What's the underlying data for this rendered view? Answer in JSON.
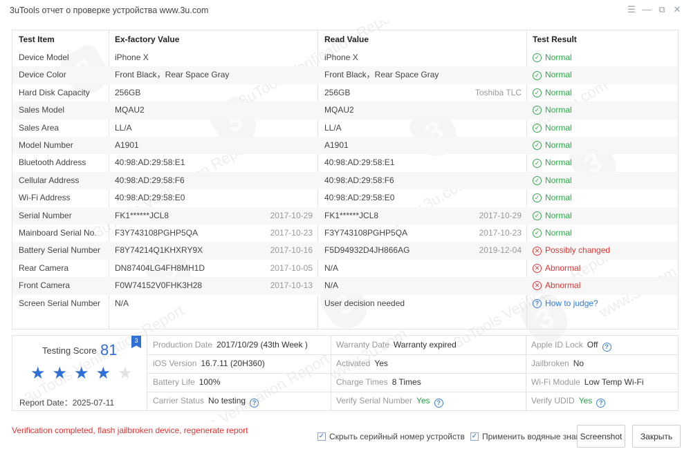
{
  "window": {
    "title": "3uTools отчет о проверке устройства www.3u.com",
    "controls": {
      "menu": "☰",
      "minimize": "—",
      "restore": "⧉",
      "close": "✕"
    }
  },
  "watermark": {
    "text": "3uTools Verification Report",
    "site": "www.3u.com",
    "logo": "3"
  },
  "table": {
    "headers": {
      "item": "Test Item",
      "factory": "Ex-factory Value",
      "read": "Read Value",
      "result": "Test Result"
    },
    "rows": [
      {
        "item": "Device Model",
        "factory": "iPhone X",
        "factory_date": "",
        "read": "iPhone X",
        "read_extra": "",
        "result": "Normal",
        "status": "ok"
      },
      {
        "item": "Device Color",
        "factory": "Front Black，Rear Space Gray",
        "factory_date": "",
        "read": "Front Black，Rear Space Gray",
        "read_extra": "",
        "result": "Normal",
        "status": "ok"
      },
      {
        "item": "Hard Disk Capacity",
        "factory": "256GB",
        "factory_date": "",
        "read": "256GB",
        "read_extra": "Toshiba TLC",
        "result": "Normal",
        "status": "ok"
      },
      {
        "item": "Sales Model",
        "factory": "MQAU2",
        "factory_date": "",
        "read": "MQAU2",
        "read_extra": "",
        "result": "Normal",
        "status": "ok"
      },
      {
        "item": "Sales Area",
        "factory": "LL/A",
        "factory_date": "",
        "read": "LL/A",
        "read_extra": "",
        "result": "Normal",
        "status": "ok"
      },
      {
        "item": "Model Number",
        "factory": "A1901",
        "factory_date": "",
        "read": "A1901",
        "read_extra": "",
        "result": "Normal",
        "status": "ok"
      },
      {
        "item": "Bluetooth Address",
        "factory": "40:98:AD:29:58:E1",
        "factory_date": "",
        "read": "40:98:AD:29:58:E1",
        "read_extra": "",
        "result": "Normal",
        "status": "ok"
      },
      {
        "item": "Cellular Address",
        "factory": "40:98:AD:29:58:F6",
        "factory_date": "",
        "read": "40:98:AD:29:58:F6",
        "read_extra": "",
        "result": "Normal",
        "status": "ok"
      },
      {
        "item": "Wi-Fi Address",
        "factory": "40:98:AD:29:58:E0",
        "factory_date": "",
        "read": "40:98:AD:29:58:E0",
        "read_extra": "",
        "result": "Normal",
        "status": "ok"
      },
      {
        "item": "Serial Number",
        "factory": "FK1******JCL8",
        "factory_date": "2017-10-29",
        "read": "FK1******JCL8",
        "read_extra": "2017-10-29",
        "result": "Normal",
        "status": "ok"
      },
      {
        "item": "Mainboard Serial No.",
        "factory": "F3Y743108PGHP5QA",
        "factory_date": "2017-10-23",
        "read": "F3Y743108PGHP5QA",
        "read_extra": "2017-10-23",
        "result": "Normal",
        "status": "ok"
      },
      {
        "item": "Battery Serial Number",
        "factory": "F8Y74214Q1KHXRY9X",
        "factory_date": "2017-10-16",
        "read": "F5D94932D4JH866AG",
        "read_extra": "2019-12-04",
        "result": "Possibly changed",
        "status": "bad"
      },
      {
        "item": "Rear Camera",
        "factory": "DN87404LG4FH8MH1D",
        "factory_date": "2017-10-05",
        "read": "N/A",
        "read_extra": "",
        "result": "Abnormal",
        "status": "bad"
      },
      {
        "item": "Front Camera",
        "factory": "F0W74152V0FHK3H28",
        "factory_date": "2017-10-13",
        "read": "N/A",
        "read_extra": "",
        "result": "Abnormal",
        "status": "bad"
      },
      {
        "item": "Screen Serial Number",
        "factory": "N/A",
        "factory_date": "",
        "read": "User decision needed",
        "read_extra": "",
        "result": "How to judge?",
        "status": "help"
      }
    ]
  },
  "summary": {
    "score_label": "Testing Score",
    "score": "81",
    "badge": "3",
    "stars_filled": 4,
    "stars_total": 5,
    "report_date": "Report Date：2025-07-11",
    "fields": [
      {
        "label": "Production Date",
        "value": "2017/10/29 (43th Week )"
      },
      {
        "label": "Warranty Date",
        "value": "Warranty expired"
      },
      {
        "label": "Apple ID Lock",
        "value": "Off"
      },
      {
        "label": "iOS Version",
        "value": "16.7.11 (20H360)"
      },
      {
        "label": "Activated",
        "value": "Yes"
      },
      {
        "label": "Jailbroken",
        "value": "No"
      },
      {
        "label": "Battery Life",
        "value": "100%"
      },
      {
        "label": "Charge Times",
        "value": "8 Times"
      },
      {
        "label": "Wi-Fi Module",
        "value": "Low Temp Wi-Fi"
      },
      {
        "label": "Carrier Status",
        "value": "No testing"
      },
      {
        "label": "Verify Serial Number",
        "value": "Yes"
      },
      {
        "label": "Verify UDID",
        "value": "Yes"
      }
    ]
  },
  "footer": {
    "status": "Verification completed, flash jailbroken device, regenerate report",
    "hide_serial_label": "Скрыть серийный номер устройств",
    "hide_serial_checked": true,
    "watermark_label": "Применить водяные знаки",
    "watermark_checked": true,
    "screenshot_label": "Screenshot",
    "close_label": "Закрыть"
  },
  "colors": {
    "ok": "#2fa64a",
    "bad": "#e03434",
    "accent": "#2f6fd6"
  }
}
